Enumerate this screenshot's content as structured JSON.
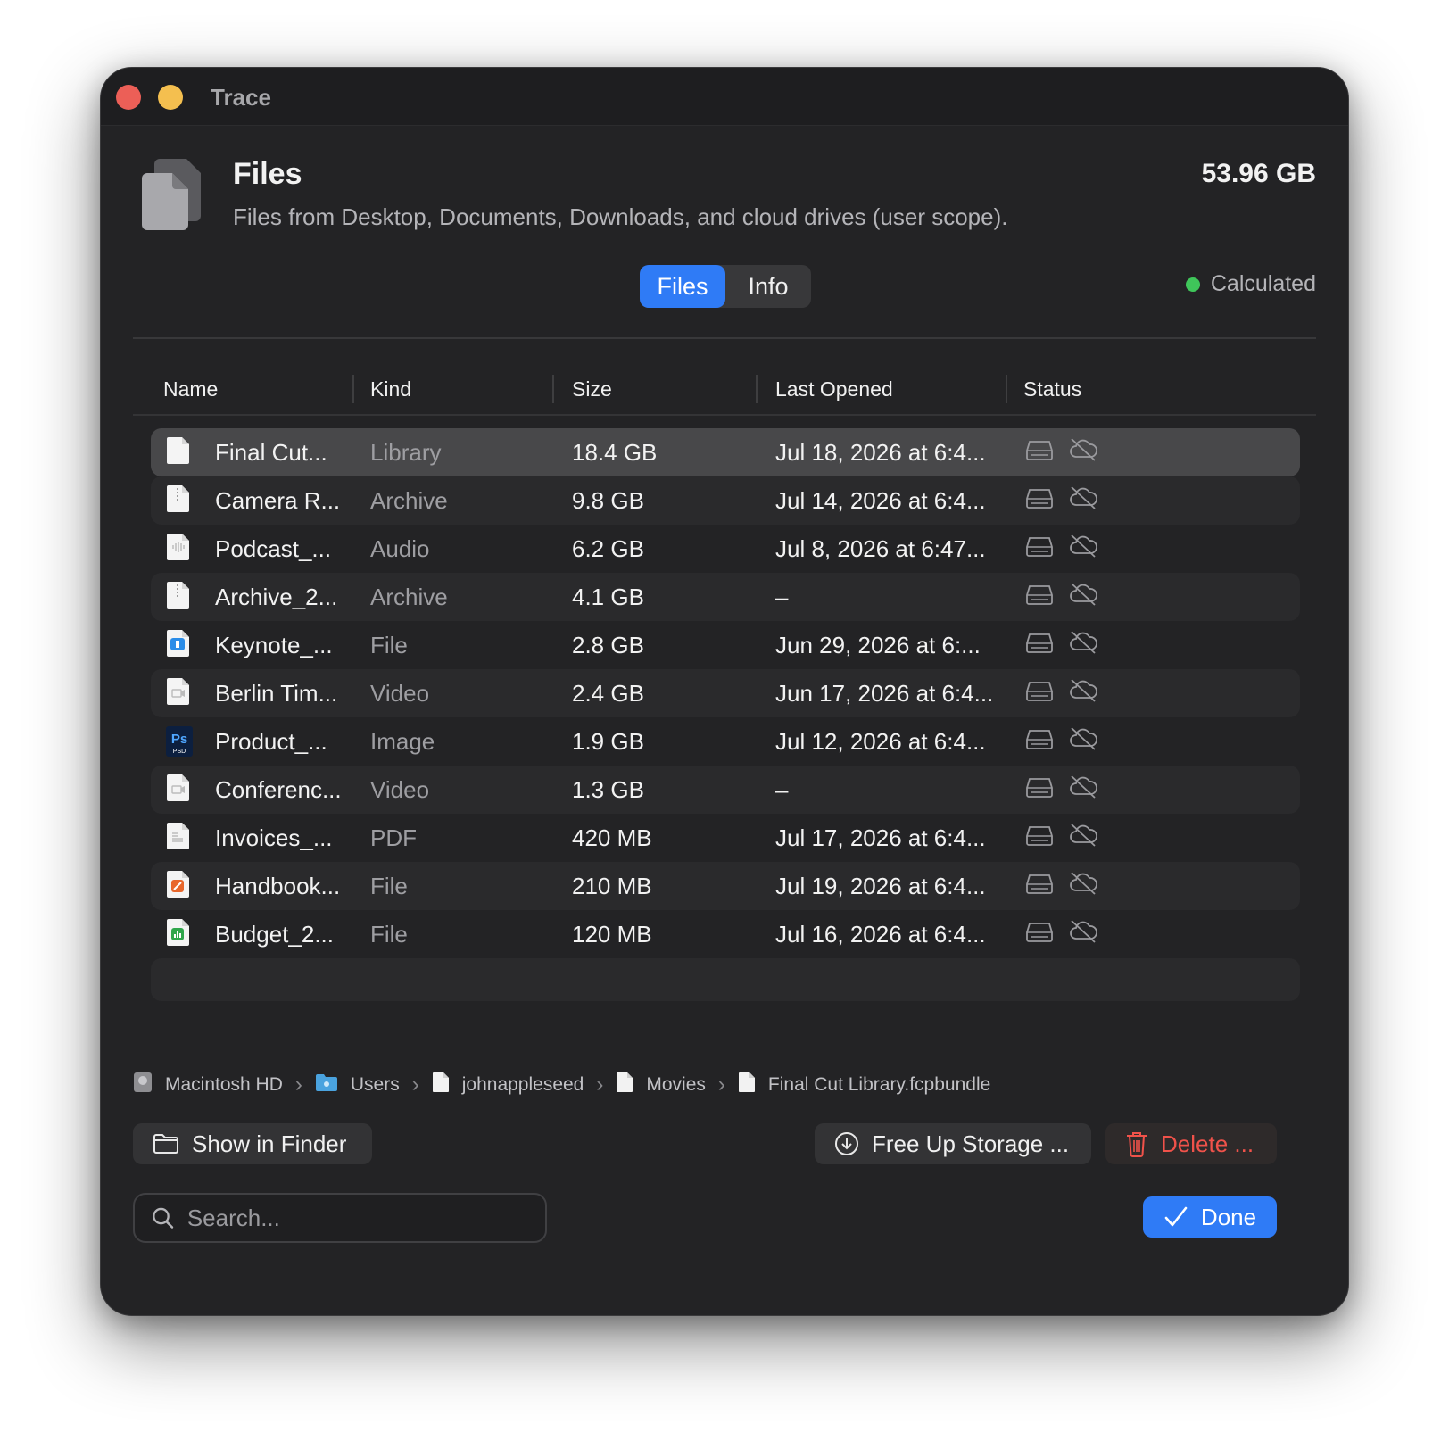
{
  "window": {
    "title": "Trace"
  },
  "header": {
    "title": "Files",
    "subtitle": "Files from Desktop, Documents, Downloads, and cloud drives (user scope).",
    "total_size": "53.96 GB"
  },
  "tabs": [
    {
      "label": "Files",
      "active": true
    },
    {
      "label": "Info",
      "active": false
    }
  ],
  "status": {
    "label": "Calculated",
    "color": "#3fc65a"
  },
  "columns": [
    "Name",
    "Kind",
    "Size",
    "Last Opened",
    "Status"
  ],
  "rows": [
    {
      "name": "Final Cut...",
      "kind": "Library",
      "size": "18.4 GB",
      "last_opened": "Jul 18, 2026 at 6:4...",
      "icon": "document-icon",
      "selected": true
    },
    {
      "name": "Camera R...",
      "kind": "Archive",
      "size": "9.8 GB",
      "last_opened": "Jul 14, 2026 at 6:4...",
      "icon": "zip-archive-icon"
    },
    {
      "name": "Podcast_...",
      "kind": "Audio",
      "size": "6.2 GB",
      "last_opened": "Jul 8, 2026 at 6:47...",
      "icon": "audio-file-icon"
    },
    {
      "name": "Archive_2...",
      "kind": "Archive",
      "size": "4.1 GB",
      "last_opened": "–",
      "icon": "zip-archive-icon"
    },
    {
      "name": "Keynote_...",
      "kind": "File",
      "size": "2.8 GB",
      "last_opened": "Jun 29, 2026 at 6:...",
      "icon": "keynote-file-icon"
    },
    {
      "name": "Berlin Tim...",
      "kind": "Video",
      "size": "2.4 GB",
      "last_opened": "Jun 17, 2026 at 6:4...",
      "icon": "video-file-icon"
    },
    {
      "name": "Product_...",
      "kind": "Image",
      "size": "1.9 GB",
      "last_opened": "Jul 12, 2026 at 6:4...",
      "icon": "psd-file-icon"
    },
    {
      "name": "Conferenc...",
      "kind": "Video",
      "size": "1.3 GB",
      "last_opened": "–",
      "icon": "video-file-icon"
    },
    {
      "name": "Invoices_...",
      "kind": "PDF",
      "size": "420 MB",
      "last_opened": "Jul 17, 2026 at 6:4...",
      "icon": "pdf-file-icon"
    },
    {
      "name": "Handbook...",
      "kind": "File",
      "size": "210 MB",
      "last_opened": "Jul 19, 2026 at 6:4...",
      "icon": "pages-file-icon"
    },
    {
      "name": "Budget_2...",
      "kind": "File",
      "size": "120 MB",
      "last_opened": "Jul 16, 2026 at 6:4...",
      "icon": "numbers-file-icon"
    }
  ],
  "breadcrumb": [
    {
      "label": "Macintosh HD",
      "icon": "hard-disk-icon"
    },
    {
      "label": "Users",
      "icon": "folder-icon"
    },
    {
      "label": "johnappleseed",
      "icon": "document-icon"
    },
    {
      "label": "Movies",
      "icon": "document-icon"
    },
    {
      "label": "Final Cut Library.fcpbundle",
      "icon": "document-icon"
    }
  ],
  "buttons": {
    "show_in_finder": "Show in Finder",
    "free_up_storage": "Free Up Storage ...",
    "delete": "Delete ...",
    "done": "Done"
  },
  "search": {
    "placeholder": "Search...",
    "value": ""
  },
  "colors": {
    "accent": "#2f7bf6",
    "danger": "#f0524a",
    "close": "#ec5f57",
    "minimize": "#f4bf4f"
  }
}
